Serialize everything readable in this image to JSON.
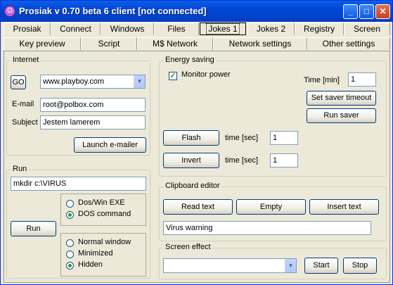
{
  "window": {
    "title": "Prosiak v 0.70 beta 6 client [not connected]"
  },
  "tabs_row1": [
    "Prosiak",
    "Connect",
    "Windows",
    "Files",
    "Jokes 1",
    "Jokes 2",
    "Registry",
    "Screen"
  ],
  "tabs_row2": [
    "Key preview",
    "Script",
    "M$ Network",
    "Network settings",
    "Other settings"
  ],
  "internet": {
    "title": "Internet",
    "go_label": "GO",
    "url": "www.playboy.com",
    "email_label": "E-mail",
    "email": "root@polbox.com",
    "subject_label": "Subject",
    "subject": "Jestem lamerem",
    "launch_label": "Launch e-mailer"
  },
  "run": {
    "title": "Run",
    "command": "mkdir c:\\VIRUS",
    "run_label": "Run",
    "type_options": [
      "Dos/Win EXE",
      "DOS command"
    ],
    "type_selected": "DOS command",
    "window_options": [
      "Normal window",
      "Minimized",
      "Hidden"
    ],
    "window_selected": "Hidden"
  },
  "energy": {
    "title": "Energy saving",
    "monitor_label": "Monitor power",
    "monitor_checked": true,
    "time_min_label": "Time [min]",
    "time_min_value": "1",
    "set_timeout_label": "Set saver timeout",
    "run_saver_label": "Run saver",
    "flash_label": "Flash",
    "flash_time_label": "time [sec]",
    "flash_time": "1",
    "invert_label": "Invert",
    "invert_time_label": "time [sec]",
    "invert_time": "1"
  },
  "clipboard": {
    "title": "Clipboard editor",
    "read_label": "Read text",
    "empty_label": "Empty",
    "insert_label": "Insert text",
    "text": "Virus warning"
  },
  "screen_effect": {
    "title": "Screen effect",
    "selected": "",
    "start_label": "Start",
    "stop_label": "Stop"
  },
  "colors": {
    "titlebar": "#0346d6",
    "face": "#ece9d8",
    "radio_dot": "#21a121"
  }
}
